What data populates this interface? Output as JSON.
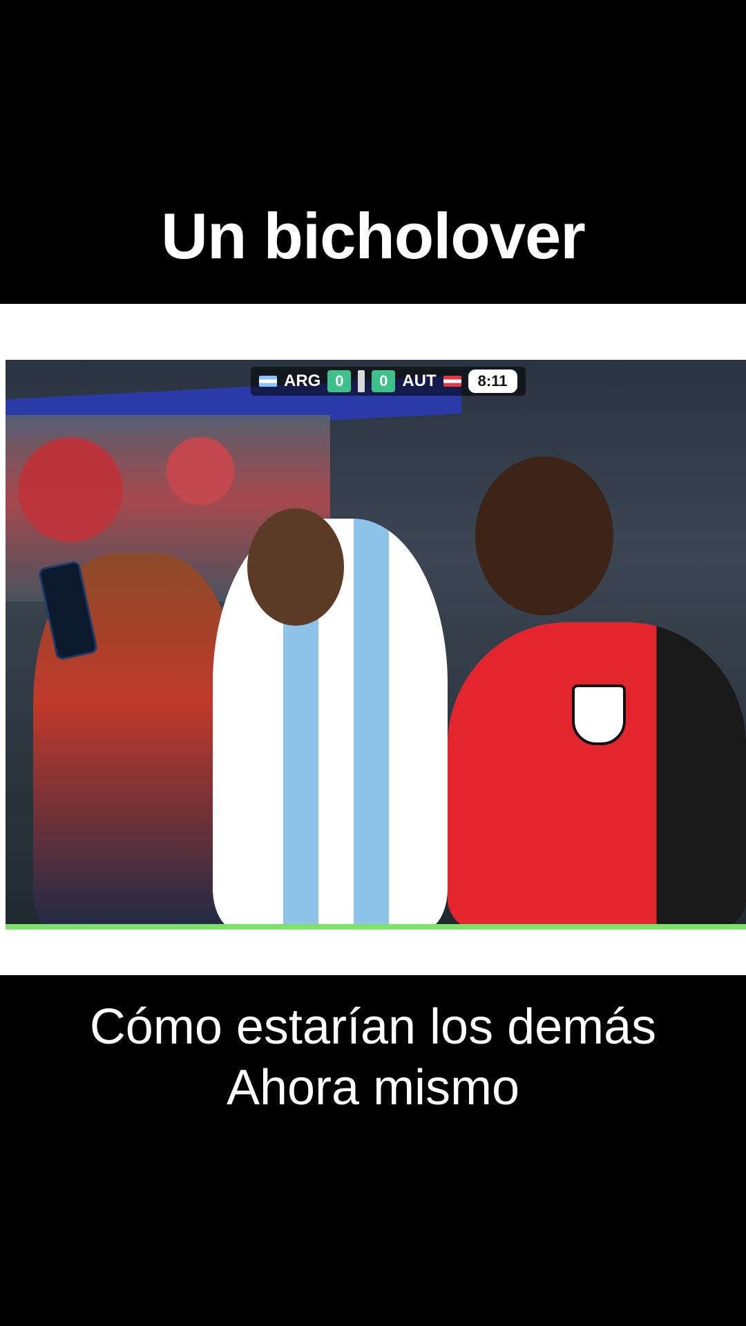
{
  "captions": {
    "top": "Un bicholover",
    "bottom_line1": "Cómo estarían los demás",
    "bottom_line2": "Ahora mismo"
  },
  "video": {
    "scoreboard": {
      "team_home": "ARG",
      "score_home": "0",
      "team_away": "AUT",
      "score_away": "0",
      "clock": "8:11"
    },
    "progress": 1.0
  },
  "colors": {
    "background": "#000000",
    "panel": "#ffffff",
    "progress": "#7fe06b",
    "score_bg": "#3fbf8a"
  }
}
